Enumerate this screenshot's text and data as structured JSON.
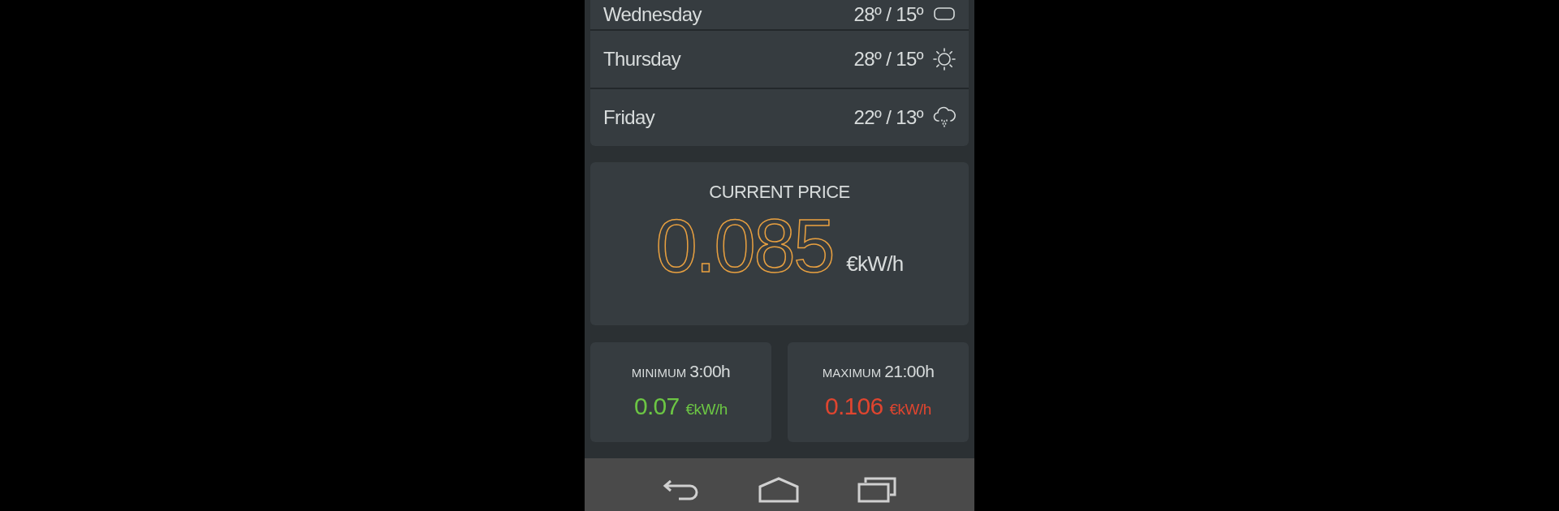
{
  "forecast": [
    {
      "day": "Wednesday",
      "temps": "28º / 15º",
      "kind": "cloudy"
    },
    {
      "day": "Thursday",
      "temps": "28º / 15º",
      "kind": "sunny"
    },
    {
      "day": "Friday",
      "temps": "22º / 13º",
      "kind": "rain"
    }
  ],
  "current_price": {
    "title": "CURRENT PRICE",
    "value": "0.085",
    "unit": "€kW/h"
  },
  "extremes": [
    {
      "label": "MINIMUM",
      "time": "3:00h",
      "value": "0.07",
      "unit": "€kW/h",
      "color": "#6cc644"
    },
    {
      "label": "MAXIMUM",
      "time": "21:00h",
      "value": "0.106",
      "unit": "€kW/h",
      "color": "#e0452f"
    }
  ],
  "nav_bar": {
    "buttons": [
      {
        "kind": "back"
      },
      {
        "kind": "home"
      },
      {
        "kind": "recents"
      }
    ]
  }
}
